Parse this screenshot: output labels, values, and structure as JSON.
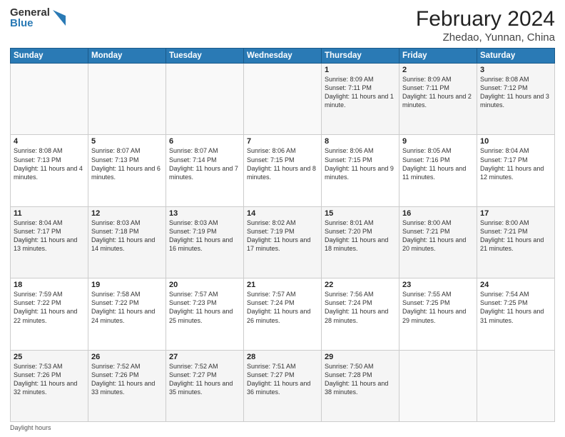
{
  "logo": {
    "general": "General",
    "blue": "Blue"
  },
  "title": {
    "month": "February 2024",
    "location": "Zhedao, Yunnan, China"
  },
  "weekdays": [
    "Sunday",
    "Monday",
    "Tuesday",
    "Wednesday",
    "Thursday",
    "Friday",
    "Saturday"
  ],
  "weeks": [
    [
      {
        "day": "",
        "info": ""
      },
      {
        "day": "",
        "info": ""
      },
      {
        "day": "",
        "info": ""
      },
      {
        "day": "",
        "info": ""
      },
      {
        "day": "1",
        "info": "Sunrise: 8:09 AM\nSunset: 7:11 PM\nDaylight: 11 hours and 1 minute."
      },
      {
        "day": "2",
        "info": "Sunrise: 8:09 AM\nSunset: 7:11 PM\nDaylight: 11 hours and 2 minutes."
      },
      {
        "day": "3",
        "info": "Sunrise: 8:08 AM\nSunset: 7:12 PM\nDaylight: 11 hours and 3 minutes."
      }
    ],
    [
      {
        "day": "4",
        "info": "Sunrise: 8:08 AM\nSunset: 7:13 PM\nDaylight: 11 hours and 4 minutes."
      },
      {
        "day": "5",
        "info": "Sunrise: 8:07 AM\nSunset: 7:13 PM\nDaylight: 11 hours and 6 minutes."
      },
      {
        "day": "6",
        "info": "Sunrise: 8:07 AM\nSunset: 7:14 PM\nDaylight: 11 hours and 7 minutes."
      },
      {
        "day": "7",
        "info": "Sunrise: 8:06 AM\nSunset: 7:15 PM\nDaylight: 11 hours and 8 minutes."
      },
      {
        "day": "8",
        "info": "Sunrise: 8:06 AM\nSunset: 7:15 PM\nDaylight: 11 hours and 9 minutes."
      },
      {
        "day": "9",
        "info": "Sunrise: 8:05 AM\nSunset: 7:16 PM\nDaylight: 11 hours and 11 minutes."
      },
      {
        "day": "10",
        "info": "Sunrise: 8:04 AM\nSunset: 7:17 PM\nDaylight: 11 hours and 12 minutes."
      }
    ],
    [
      {
        "day": "11",
        "info": "Sunrise: 8:04 AM\nSunset: 7:17 PM\nDaylight: 11 hours and 13 minutes."
      },
      {
        "day": "12",
        "info": "Sunrise: 8:03 AM\nSunset: 7:18 PM\nDaylight: 11 hours and 14 minutes."
      },
      {
        "day": "13",
        "info": "Sunrise: 8:03 AM\nSunset: 7:19 PM\nDaylight: 11 hours and 16 minutes."
      },
      {
        "day": "14",
        "info": "Sunrise: 8:02 AM\nSunset: 7:19 PM\nDaylight: 11 hours and 17 minutes."
      },
      {
        "day": "15",
        "info": "Sunrise: 8:01 AM\nSunset: 7:20 PM\nDaylight: 11 hours and 18 minutes."
      },
      {
        "day": "16",
        "info": "Sunrise: 8:00 AM\nSunset: 7:21 PM\nDaylight: 11 hours and 20 minutes."
      },
      {
        "day": "17",
        "info": "Sunrise: 8:00 AM\nSunset: 7:21 PM\nDaylight: 11 hours and 21 minutes."
      }
    ],
    [
      {
        "day": "18",
        "info": "Sunrise: 7:59 AM\nSunset: 7:22 PM\nDaylight: 11 hours and 22 minutes."
      },
      {
        "day": "19",
        "info": "Sunrise: 7:58 AM\nSunset: 7:22 PM\nDaylight: 11 hours and 24 minutes."
      },
      {
        "day": "20",
        "info": "Sunrise: 7:57 AM\nSunset: 7:23 PM\nDaylight: 11 hours and 25 minutes."
      },
      {
        "day": "21",
        "info": "Sunrise: 7:57 AM\nSunset: 7:24 PM\nDaylight: 11 hours and 26 minutes."
      },
      {
        "day": "22",
        "info": "Sunrise: 7:56 AM\nSunset: 7:24 PM\nDaylight: 11 hours and 28 minutes."
      },
      {
        "day": "23",
        "info": "Sunrise: 7:55 AM\nSunset: 7:25 PM\nDaylight: 11 hours and 29 minutes."
      },
      {
        "day": "24",
        "info": "Sunrise: 7:54 AM\nSunset: 7:25 PM\nDaylight: 11 hours and 31 minutes."
      }
    ],
    [
      {
        "day": "25",
        "info": "Sunrise: 7:53 AM\nSunset: 7:26 PM\nDaylight: 11 hours and 32 minutes."
      },
      {
        "day": "26",
        "info": "Sunrise: 7:52 AM\nSunset: 7:26 PM\nDaylight: 11 hours and 33 minutes."
      },
      {
        "day": "27",
        "info": "Sunrise: 7:52 AM\nSunset: 7:27 PM\nDaylight: 11 hours and 35 minutes."
      },
      {
        "day": "28",
        "info": "Sunrise: 7:51 AM\nSunset: 7:27 PM\nDaylight: 11 hours and 36 minutes."
      },
      {
        "day": "29",
        "info": "Sunrise: 7:50 AM\nSunset: 7:28 PM\nDaylight: 11 hours and 38 minutes."
      },
      {
        "day": "",
        "info": ""
      },
      {
        "day": "",
        "info": ""
      }
    ]
  ],
  "footer": {
    "daylight_label": "Daylight hours"
  }
}
